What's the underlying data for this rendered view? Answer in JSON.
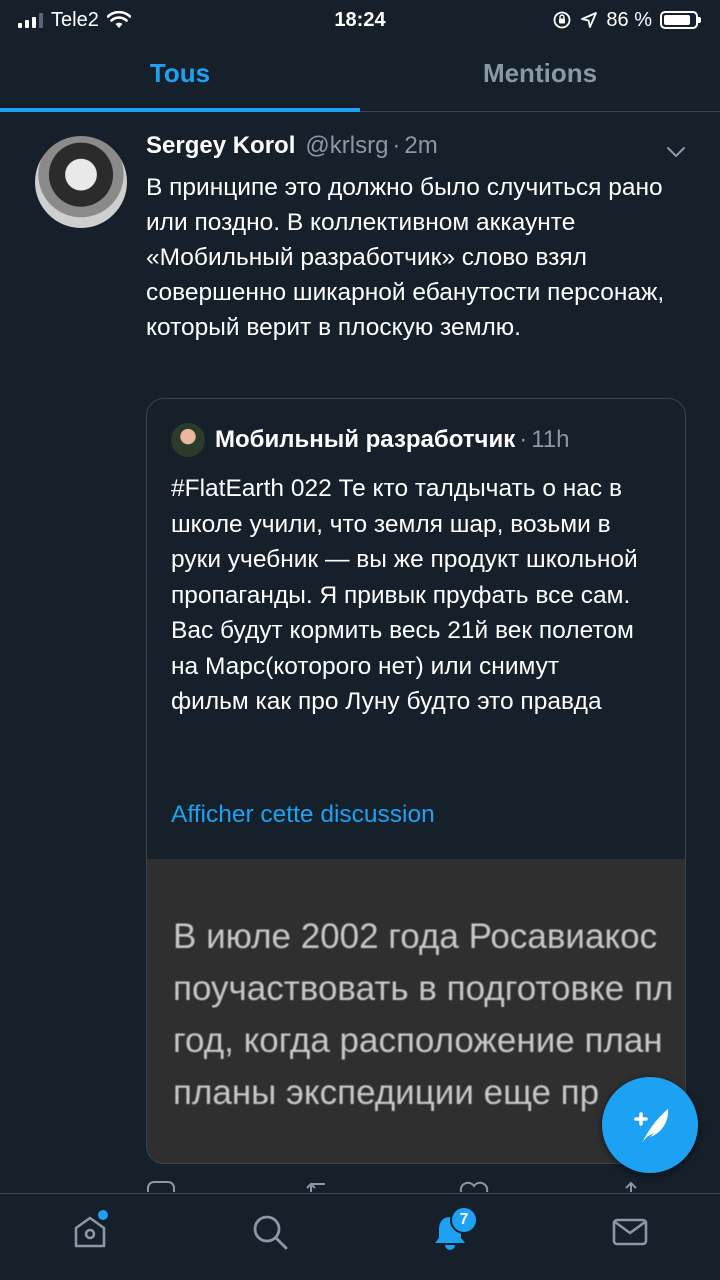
{
  "status_bar": {
    "carrier": "Tele2",
    "time": "18:24",
    "battery": "86 %",
    "battery_level": 0.86
  },
  "tabs": [
    {
      "label": "Tous",
      "active": true
    },
    {
      "label": "Mentions",
      "active": false
    }
  ],
  "tweet": {
    "author_name": "Sergey Korol",
    "author_handle": "@krlsrg",
    "separator": "·",
    "time": "2m",
    "text": "В принципе это должно было случиться рано или поздно. В коллективном аккаунте «Мобильный разработчик» слово взял совершенно шикарной ебанутости персонаж, который верит в плоскую землю.",
    "quote": {
      "author_name": "Мобильный разработчик",
      "separator": "·",
      "time": "11h",
      "text": "#FlatEarth 022 Те кто талдычать о нас в школе учили, что земля шар, возьми в руки учебник — вы же продукт школьной пропаганды. Я привык пруфать все сам. Вас будут кормить весь 21й век полетом на Марс(которого нет) или снимут фильм как про Луну будто это правда",
      "show_thread": "Afficher cette discussion",
      "image_lines": [
        "В июле 2002 года Росавиакос",
        "поучаствовать в подготовке пл",
        "год, когда расположение план",
        "планы экспедиции еще пр"
      ]
    }
  },
  "nav": {
    "notifications_badge": "7"
  },
  "colors": {
    "background": "#15202b",
    "accent": "#1da1f2",
    "secondary_text": "#8899a6",
    "border": "#38444d"
  }
}
